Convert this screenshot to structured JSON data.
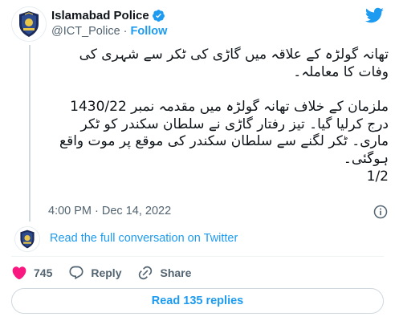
{
  "author": {
    "display_name": "Islamabad Police",
    "handle": "@ICT_Police",
    "separator": "·",
    "follow_label": "Follow"
  },
  "tweet": {
    "paragraph_1": "تھانہ گولڑہ کے علاقہ میں گاڑی کی ٹکر سے شہری کی وفات کا معاملہ۔",
    "paragraph_2": "ملزمان کے خلاف تھانہ گولڑہ میں مقدمہ نمبر 1430/22 درج کرلیا گیا۔ تیز رفتار گاڑی نے سلطان سکندر کو ٹکر ماری۔ ٹکر لگنے سے سلطان سکندر کی موقع پر موت واقع ہوگئی۔",
    "page_count": "1/2",
    "timestamp": "4:00 PM · Dec 14, 2022"
  },
  "conversation": {
    "link_label": "Read the full conversation on Twitter"
  },
  "actions": {
    "like_count": "745",
    "reply_label": "Reply",
    "share_label": "Share"
  },
  "replies": {
    "button_label": "Read 135 replies"
  },
  "colors": {
    "accent": "#1d9bf0",
    "like": "#f91880",
    "text": "#0f1419",
    "muted": "#536471",
    "border": "#cfd9de",
    "badge_navy": "#1b2a5a"
  },
  "icons": {
    "verified": "verified-badge-icon",
    "twitter": "twitter-bird-icon",
    "info": "info-icon",
    "like": "heart-icon",
    "reply": "speech-bubble-icon",
    "share": "share-icon"
  }
}
